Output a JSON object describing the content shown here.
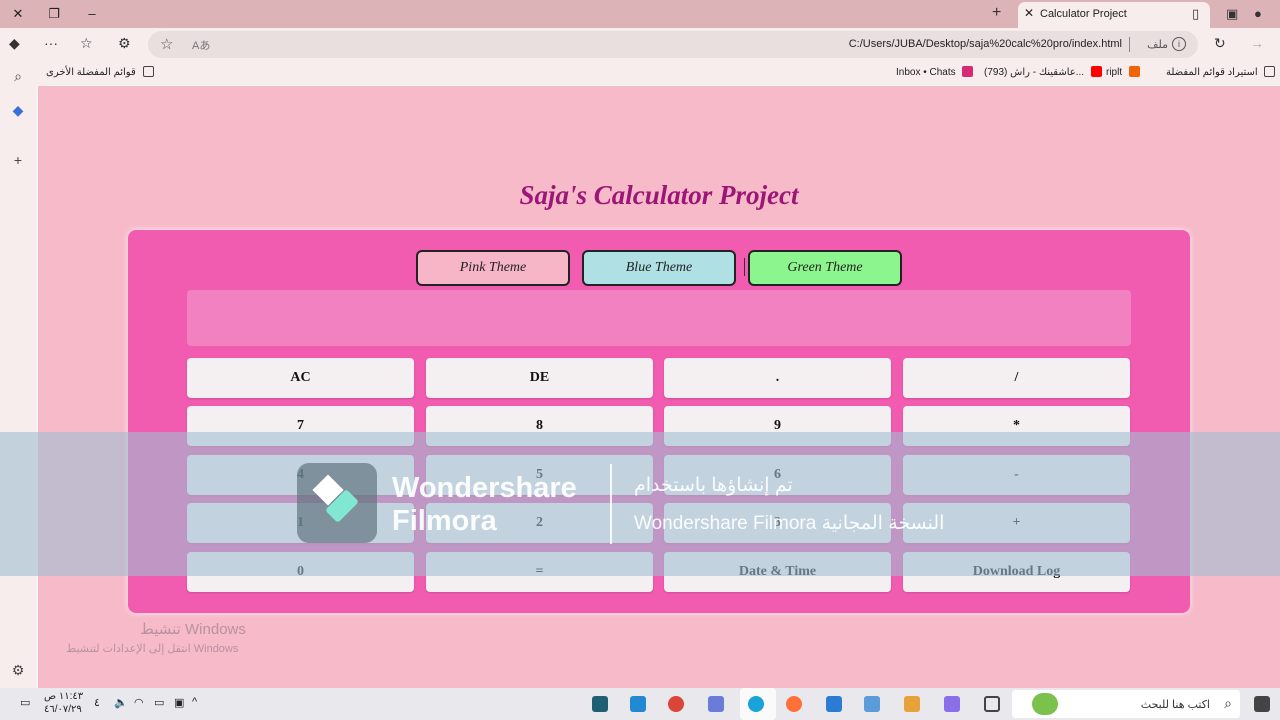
{
  "browser": {
    "tab_title": "Calculator Project",
    "url": "C:/Users/JUBA/Desktop/saja%20calc%20pro/index.html",
    "file_label": "ملف",
    "bookmarks": [
      {
        "label": "استيراد قوائم المفضلة",
        "icon_color": "#555555"
      },
      {
        "label": "riplt",
        "icon_color": "#f26207"
      },
      {
        "label": "(793) عاشقينك - راش...",
        "icon_color": "#ff0000"
      },
      {
        "label": "Inbox • Chats",
        "icon_color": "#d62976"
      }
    ],
    "other_favorites": "قوائم المفضلة الأخرى"
  },
  "page": {
    "title": "Saja's Calculator Project",
    "themes": [
      {
        "label": "Pink Theme",
        "color": "#f7b6c8"
      },
      {
        "label": "Blue Theme",
        "color": "#aee0e4"
      },
      {
        "label": "Green Theme",
        "color": "#8df58d"
      }
    ],
    "display_value": "",
    "keys": [
      [
        "AC",
        "DE",
        ".",
        "/"
      ],
      [
        "7",
        "8",
        "9",
        "*"
      ],
      [
        "4",
        "5",
        "6",
        "-"
      ],
      [
        "1",
        "2",
        "3",
        "+"
      ],
      [
        "0",
        "=",
        "Date & Time",
        "Download Log"
      ]
    ],
    "colors": {
      "background": "#f7bac9",
      "panel": "#f15cb0",
      "display": "#f181c1",
      "title": "#9b1676"
    }
  },
  "watermark": {
    "line1": "تنشيط Windows",
    "line2": "انتقل إلى الإعدادات لتنشيط Windows"
  },
  "overlay": {
    "brand_line1": "Wondershare",
    "brand_line2": "Filmora",
    "msg_line1": "تم إنشاؤها باستخدام",
    "msg_line2": "النسخة المجانية Wondershare Filmora"
  },
  "taskbar": {
    "search_placeholder": "اكتب هنا للبحث",
    "time": "١١:٤٣ ص",
    "date": "٤٦/٠٧/٢٩",
    "day": "٤"
  }
}
